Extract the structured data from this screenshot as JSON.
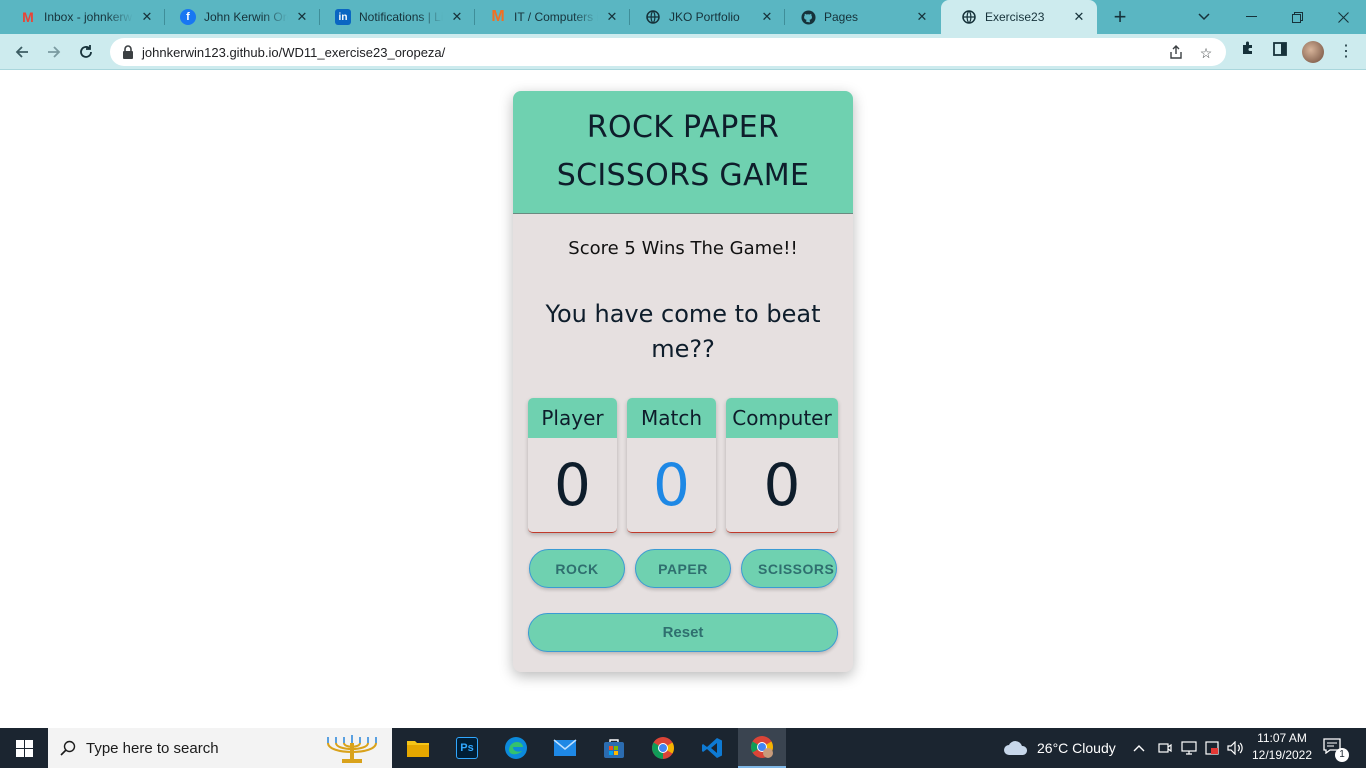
{
  "browser": {
    "tabs": [
      {
        "title": "Inbox - johnkerwin",
        "icon": "gmail-icon"
      },
      {
        "title": "John Kerwin Oropeza",
        "icon": "facebook-icon"
      },
      {
        "title": "Notifications | LinkedIn",
        "icon": "linkedin-icon"
      },
      {
        "title": "IT / Computers in",
        "icon": "m-icon"
      },
      {
        "title": "JKO Portfolio",
        "icon": "globe-icon"
      },
      {
        "title": "Pages",
        "icon": "github-icon"
      },
      {
        "title": "Exercise23",
        "icon": "globe-icon"
      }
    ],
    "new_tab": "+",
    "url": "johnkerwin123.github.io/WD11_exercise23_oropeza/"
  },
  "game": {
    "title": "ROCK PAPER SCISSORS GAME",
    "rule": "Score 5 Wins The Game!!",
    "message": "You have come to beat me??",
    "scores": {
      "player_label": "Player",
      "player_value": "0",
      "match_label": "Match",
      "match_value": "0",
      "computer_label": "Computer",
      "computer_value": "0"
    },
    "buttons": {
      "rock": "ROCK",
      "paper": "PAPER",
      "scissors": "SCISSORS",
      "reset": "Reset"
    },
    "colors": {
      "accent": "#6fd1b0",
      "card": "#e6e0e0",
      "match_value": "#1e88e5"
    }
  },
  "taskbar": {
    "search_placeholder": "Type here to search",
    "weather": "26°C  Cloudy",
    "time": "11:07 AM",
    "date": "12/19/2022",
    "notification_count": "1",
    "apps": [
      "file-explorer-icon",
      "photoshop-icon",
      "edge-icon",
      "mail-icon",
      "store-icon",
      "chrome-icon",
      "vscode-icon",
      "chrome-profile-icon"
    ]
  }
}
